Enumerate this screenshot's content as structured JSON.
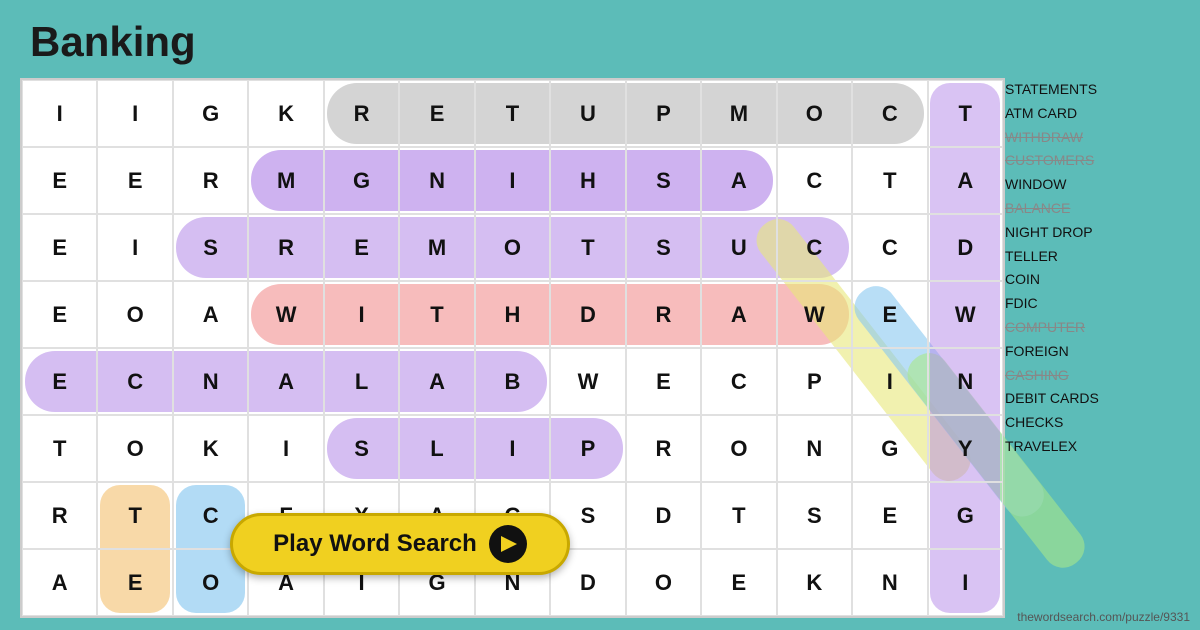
{
  "title": "Banking",
  "grid": [
    [
      "I",
      "I",
      "G",
      "K",
      "R",
      "E",
      "T",
      "U",
      "P",
      "M",
      "O",
      "C",
      "T"
    ],
    [
      "E",
      "E",
      "R",
      "M",
      "G",
      "N",
      "I",
      "H",
      "S",
      "A",
      "C",
      "T",
      "A"
    ],
    [
      "E",
      "I",
      "S",
      "R",
      "E",
      "M",
      "O",
      "T",
      "S",
      "U",
      "C",
      "C",
      "D"
    ],
    [
      "E",
      "O",
      "A",
      "W",
      "I",
      "T",
      "H",
      "D",
      "R",
      "A",
      "W",
      "E",
      "W"
    ],
    [
      "E",
      "C",
      "N",
      "A",
      "L",
      "A",
      "B",
      "W",
      "E",
      "C",
      "P",
      "I",
      "N"
    ],
    [
      "T",
      "O",
      "K",
      "I",
      "S",
      "L",
      "I",
      "P",
      "R",
      "O",
      "N",
      "G",
      "Y"
    ],
    [
      "R",
      "T",
      "C",
      "F",
      "X",
      "A",
      "C",
      "S",
      "D",
      "T",
      "S",
      "E",
      "G"
    ],
    [
      "A",
      "E",
      "O",
      "A",
      "I",
      "G",
      "N",
      "D",
      "O",
      "E",
      "K",
      "N",
      "I"
    ]
  ],
  "word_list": [
    {
      "word": "STATEMENTS",
      "found": false
    },
    {
      "word": "ATM CARD",
      "found": false
    },
    {
      "word": "WITHDRAW",
      "found": true
    },
    {
      "word": "CUSTOMERS",
      "found": true
    },
    {
      "word": "WINDOW",
      "found": false
    },
    {
      "word": "BALANCE",
      "found": true
    },
    {
      "word": "NIGHT DROP",
      "found": false
    },
    {
      "word": "TELLER",
      "found": false
    },
    {
      "word": "COIN",
      "found": false
    },
    {
      "word": "FDIC",
      "found": false
    },
    {
      "word": "COMPUTER",
      "found": true
    },
    {
      "word": "FOREIGN",
      "found": false
    },
    {
      "word": "CASHING",
      "found": true
    },
    {
      "word": "DEBIT CARDS",
      "found": false
    },
    {
      "word": "CHECKS",
      "found": false
    },
    {
      "word": "TRAVELEX",
      "found": false
    }
  ],
  "play_button": {
    "label": "Play Word Search"
  },
  "attribution": "thewordsearch.com/puzzle/9331"
}
